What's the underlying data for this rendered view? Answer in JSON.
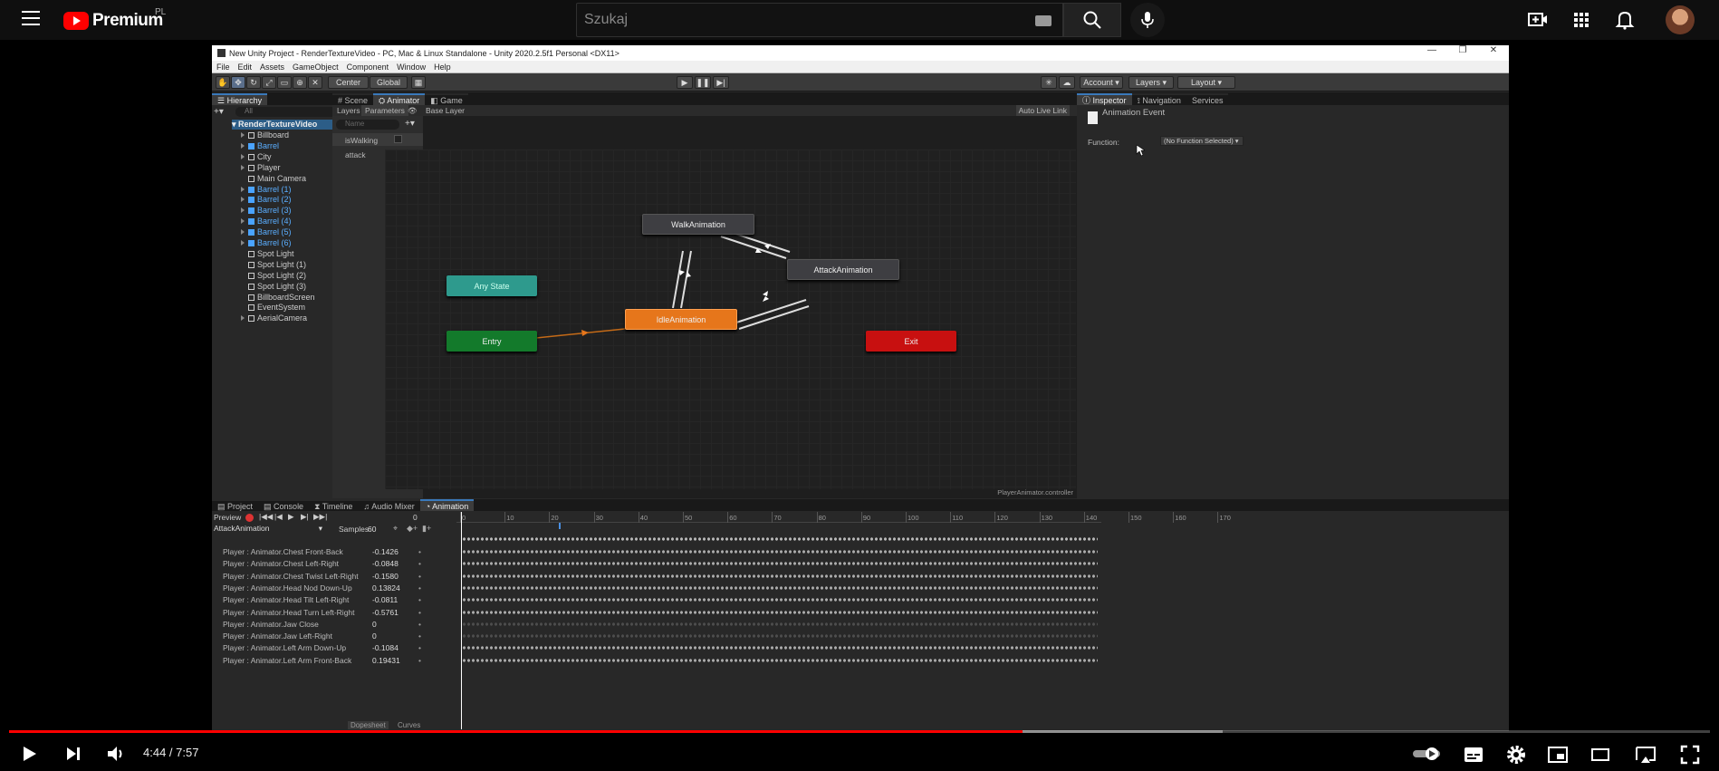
{
  "youtube": {
    "logo_text": "Premium",
    "region": "PL",
    "search_placeholder": "Szukaj",
    "time_current": "4:44",
    "time_separator": " / ",
    "time_total": "7:57",
    "progress_fraction": 0.596
  },
  "unity": {
    "window_title": "New Unity Project - RenderTextureVideo - PC, Mac & Linux Standalone - Unity 2020.2.5f1 Personal <DX11>",
    "menu": [
      "File",
      "Edit",
      "Assets",
      "GameObject",
      "Component",
      "Window",
      "Help"
    ],
    "toolbar": {
      "center": "Center",
      "global": "Global",
      "account": "Account",
      "layers": "Layers",
      "layout": "Layout"
    },
    "hierarchy": {
      "tab": "Hierarchy",
      "search_placeholder": "All",
      "root": "RenderTextureVideo",
      "items": [
        {
          "label": "Billboard",
          "prefab": false
        },
        {
          "label": "Barrel",
          "prefab": true
        },
        {
          "label": "City",
          "prefab": false
        },
        {
          "label": "Player",
          "prefab": false
        },
        {
          "label": "Main Camera",
          "prefab": false
        },
        {
          "label": "Barrel (1)",
          "prefab": true
        },
        {
          "label": "Barrel (2)",
          "prefab": true
        },
        {
          "label": "Barrel (3)",
          "prefab": true
        },
        {
          "label": "Barrel (4)",
          "prefab": true
        },
        {
          "label": "Barrel (5)",
          "prefab": true
        },
        {
          "label": "Barrel (6)",
          "prefab": true
        },
        {
          "label": "Spot Light",
          "prefab": false
        },
        {
          "label": "Spot Light (1)",
          "prefab": false
        },
        {
          "label": "Spot Light (2)",
          "prefab": false
        },
        {
          "label": "Spot Light (3)",
          "prefab": false
        },
        {
          "label": "BillboardScreen",
          "prefab": false
        },
        {
          "label": "EventSystem",
          "prefab": false
        },
        {
          "label": "AerialCamera",
          "prefab": false
        }
      ]
    },
    "center_tabs": {
      "scene": "Scene",
      "animator": "Animator",
      "game": "Game"
    },
    "animator": {
      "layers_tab": "Layers",
      "parameters_tab": "Parameters",
      "breadcrumb": "Base Layer",
      "auto_live_link": "Auto Live Link",
      "name_placeholder": "Name",
      "params": [
        {
          "name": "isWalking",
          "type": "bool"
        },
        {
          "name": "attack",
          "type": "trigger"
        }
      ],
      "states": {
        "walk": "WalkAnimation",
        "attack": "AttackAnimation",
        "any": "Any State",
        "idle": "IdleAnimation",
        "entry": "Entry",
        "exit": "Exit"
      },
      "controller_path": "PlayerAnimator.controller",
      "colors": {
        "idle": "#e6761b",
        "entry": "#137a2b",
        "exit": "#c81010",
        "any": "#2e9a8d",
        "state": "#3e3e42"
      }
    },
    "inspector": {
      "tabs": [
        "Inspector",
        "Navigation",
        "Services"
      ],
      "header": "Animation Event",
      "function_label": "Function:",
      "function_value": "(No Function Selected)"
    },
    "bottom_tabs": [
      "Project",
      "Console",
      "Timeline",
      "Audio Mixer",
      "Animation"
    ],
    "animation": {
      "preview": "Preview",
      "frame": "0",
      "clip": "AttackAnimation",
      "samples_label": "Samples",
      "samples": "60",
      "ruler": [
        "0",
        "10",
        "20",
        "30",
        "40",
        "50",
        "60",
        "70",
        "80",
        "90",
        "100",
        "110",
        "120",
        "130",
        "140",
        "150",
        "160",
        "170"
      ],
      "curves": [
        {
          "name": "Player : Animator.Chest Front-Back",
          "value": "-0.1426"
        },
        {
          "name": "Player : Animator.Chest Left-Right",
          "value": "-0.0848"
        },
        {
          "name": "Player : Animator.Chest Twist Left-Right",
          "value": "-0.1580"
        },
        {
          "name": "Player : Animator.Head Nod Down-Up",
          "value": "0.13824"
        },
        {
          "name": "Player : Animator.Head Tilt Left-Right",
          "value": "-0.0811"
        },
        {
          "name": "Player : Animator.Head Turn Left-Right",
          "value": "-0.5761"
        },
        {
          "name": "Player : Animator.Jaw Close",
          "value": "0"
        },
        {
          "name": "Player : Animator.Jaw Left-Right",
          "value": "0"
        },
        {
          "name": "Player : Animator.Left Arm Down-Up",
          "value": "-0.1084"
        },
        {
          "name": "Player : Animator.Left Arm Front-Back",
          "value": "0.19431"
        }
      ],
      "dopesheet": "Dopesheet",
      "curves_tab": "Curves"
    }
  }
}
